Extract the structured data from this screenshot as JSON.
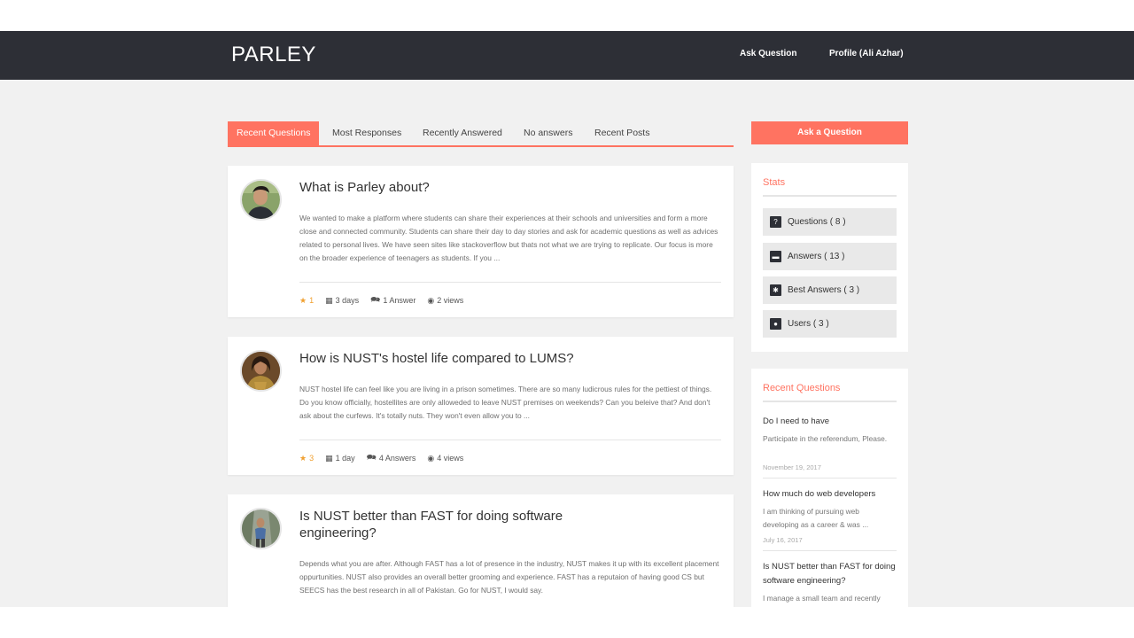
{
  "header": {
    "logo": "PARLEY",
    "nav": {
      "ask_question": "Ask Question",
      "profile": "Profile (Ali Azhar)"
    }
  },
  "tabs": [
    {
      "label": "Recent Questions",
      "active": true
    },
    {
      "label": "Most Responses"
    },
    {
      "label": "Recently Answered"
    },
    {
      "label": "No answers"
    },
    {
      "label": "Recent Posts"
    }
  ],
  "questions": [
    {
      "title": "What is Parley about?",
      "body": "We wanted to make a platform where students can share their experiences at their schools and universities and form a more close and connected community. Students can share their day to day stories and ask for academic questions as well as advices related to personal lives. We have seen sites like stackoverflow but thats not what we are trying to replicate. Our focus is more on the broader experience of teenagers as students. If you ...",
      "stars": "1",
      "time": "3 days",
      "answers": "1 Answer",
      "views": "2 views"
    },
    {
      "title": "How is NUST's hostel life compared to LUMS?",
      "body": "NUST hostel life can feel like you are living in a prison sometimes. There are so many ludicrous rules for the pettiest of things. Do you know officially, hostellites are only alloweded to leave NUST premises on weekends? Can you beleive that? And don't ask about the curfews. It's totally nuts. They won't even allow you to ...",
      "stars": "3",
      "time": "1 day",
      "answers": "4 Answers",
      "views": "4 views"
    },
    {
      "title": "Is NUST better than FAST for doing software engineering?",
      "body": "Depends what you are after. Although FAST has a lot of presence in the industry, NUST makes it up with its excellent placement oppurtunities. NUST also provides an overall better grooming and experience. FAST has a reputaion of having good CS but SEECS has the best research in all of Pakistan. Go for NUST, I would say."
    }
  ],
  "sidebar": {
    "ask_button": "Ask a Question",
    "stats": {
      "title": "Stats",
      "items": [
        {
          "label": "Questions ( 8 )",
          "icon": "question-icon"
        },
        {
          "label": "Answers ( 13 )",
          "icon": "comment-icon"
        },
        {
          "label": "Best Answers ( 3 )",
          "icon": "asterisk-icon"
        },
        {
          "label": "Users ( 3 )",
          "icon": "user-icon"
        }
      ]
    },
    "recent": {
      "title": "Recent Questions",
      "items": [
        {
          "title": "Do I need to have",
          "desc": "Participate in the referendum, Please.",
          "date": "November 19, 2017"
        },
        {
          "title": "How much do web developers",
          "desc": "I am thinking of pursuing web developing as a career & was ...",
          "date": "July 16, 2017"
        },
        {
          "title": "Is NUST better than FAST for doing software engineering?",
          "desc": "I manage a small team and recently"
        }
      ]
    }
  },
  "colors": {
    "accent": "#ff7361",
    "header_bg": "#2d2f36",
    "page_bg": "#f1f1f1",
    "star": "#f0a030"
  }
}
